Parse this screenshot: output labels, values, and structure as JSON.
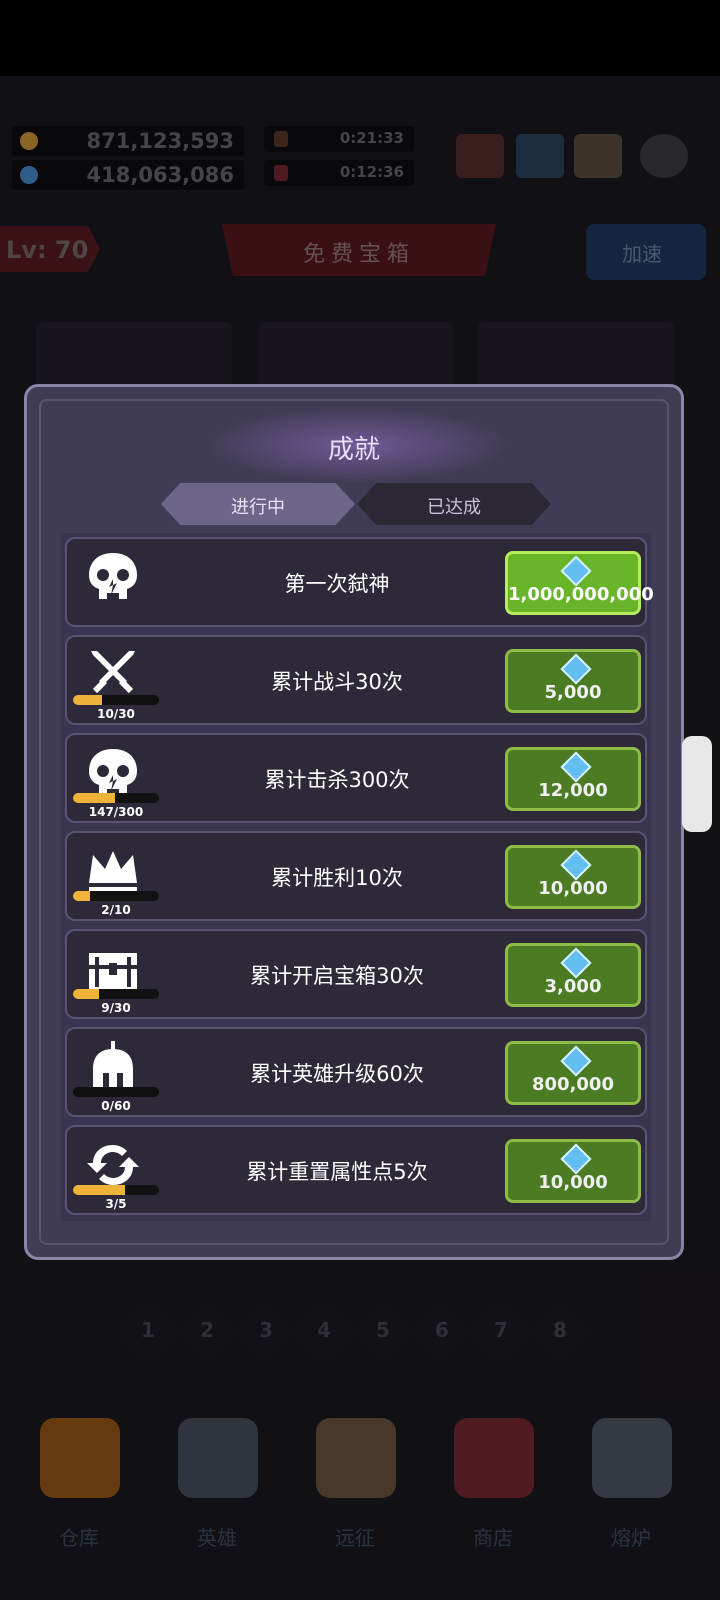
{
  "currencies": [
    {
      "name": "gold",
      "icon": "gold-icon",
      "value": "871,123,593",
      "color": "#d39b36"
    },
    {
      "name": "gem",
      "icon": "gem-icon",
      "value": "418,063,086",
      "color": "#4b8ed1"
    }
  ],
  "timers": [
    {
      "icon": "hero-timer-icon",
      "value": "0:21:33"
    },
    {
      "icon": "gift-timer-icon",
      "value": "0:12:36"
    }
  ],
  "top_icons": [
    "megaphone-icon",
    "calendar-icon",
    "mail-icon",
    "gear-icon"
  ],
  "level": "Lv: 70",
  "free_chest": "免费宝箱",
  "speed_button": "加速",
  "modal": {
    "title": "成就",
    "tabs": [
      "进行中",
      "已达成"
    ],
    "rows": [
      {
        "icon": "skull-icon",
        "title": "第一次弑神",
        "progress": null,
        "reward": "1,000,000,000",
        "claimable": true
      },
      {
        "icon": "crossed-swords-icon",
        "title": "累计战斗30次",
        "progress": {
          "current": 10,
          "total": 30,
          "text": "10/30"
        },
        "reward": "5,000",
        "claimable": false
      },
      {
        "icon": "skull-icon",
        "title": "累计击杀300次",
        "progress": {
          "current": 147,
          "total": 300,
          "text": "147/300"
        },
        "reward": "12,000",
        "claimable": false
      },
      {
        "icon": "crown-icon",
        "title": "累计胜利10次",
        "progress": {
          "current": 2,
          "total": 10,
          "text": "2/10"
        },
        "reward": "10,000",
        "claimable": false
      },
      {
        "icon": "treasure-chest-icon",
        "title": "累计开启宝箱30次",
        "progress": {
          "current": 9,
          "total": 30,
          "text": "9/30"
        },
        "reward": "3,000",
        "claimable": false
      },
      {
        "icon": "helmet-icon",
        "title": "累计英雄升级60次",
        "progress": {
          "current": 0,
          "total": 60,
          "text": "0/60"
        },
        "reward": "800,000",
        "claimable": false
      },
      {
        "icon": "refresh-icon",
        "title": "累计重置属性点5次",
        "progress": {
          "current": 3,
          "total": 5,
          "text": "3/5"
        },
        "reward": "10,000",
        "claimable": false
      }
    ]
  },
  "pages": [
    "1",
    "2",
    "3",
    "4",
    "5",
    "6",
    "7",
    "8"
  ],
  "bottom_nav": [
    {
      "label": "仓库",
      "icon": "bag-icon",
      "color": "#9a5a16"
    },
    {
      "label": "英雄",
      "icon": "helmet-icon",
      "color": "#49515e"
    },
    {
      "label": "远征",
      "icon": "portal-icon",
      "color": "#6d5740"
    },
    {
      "label": "商店",
      "icon": "shop-icon",
      "color": "#7a2a32"
    },
    {
      "label": "熔炉",
      "icon": "anvil-icon",
      "color": "#505866"
    }
  ]
}
